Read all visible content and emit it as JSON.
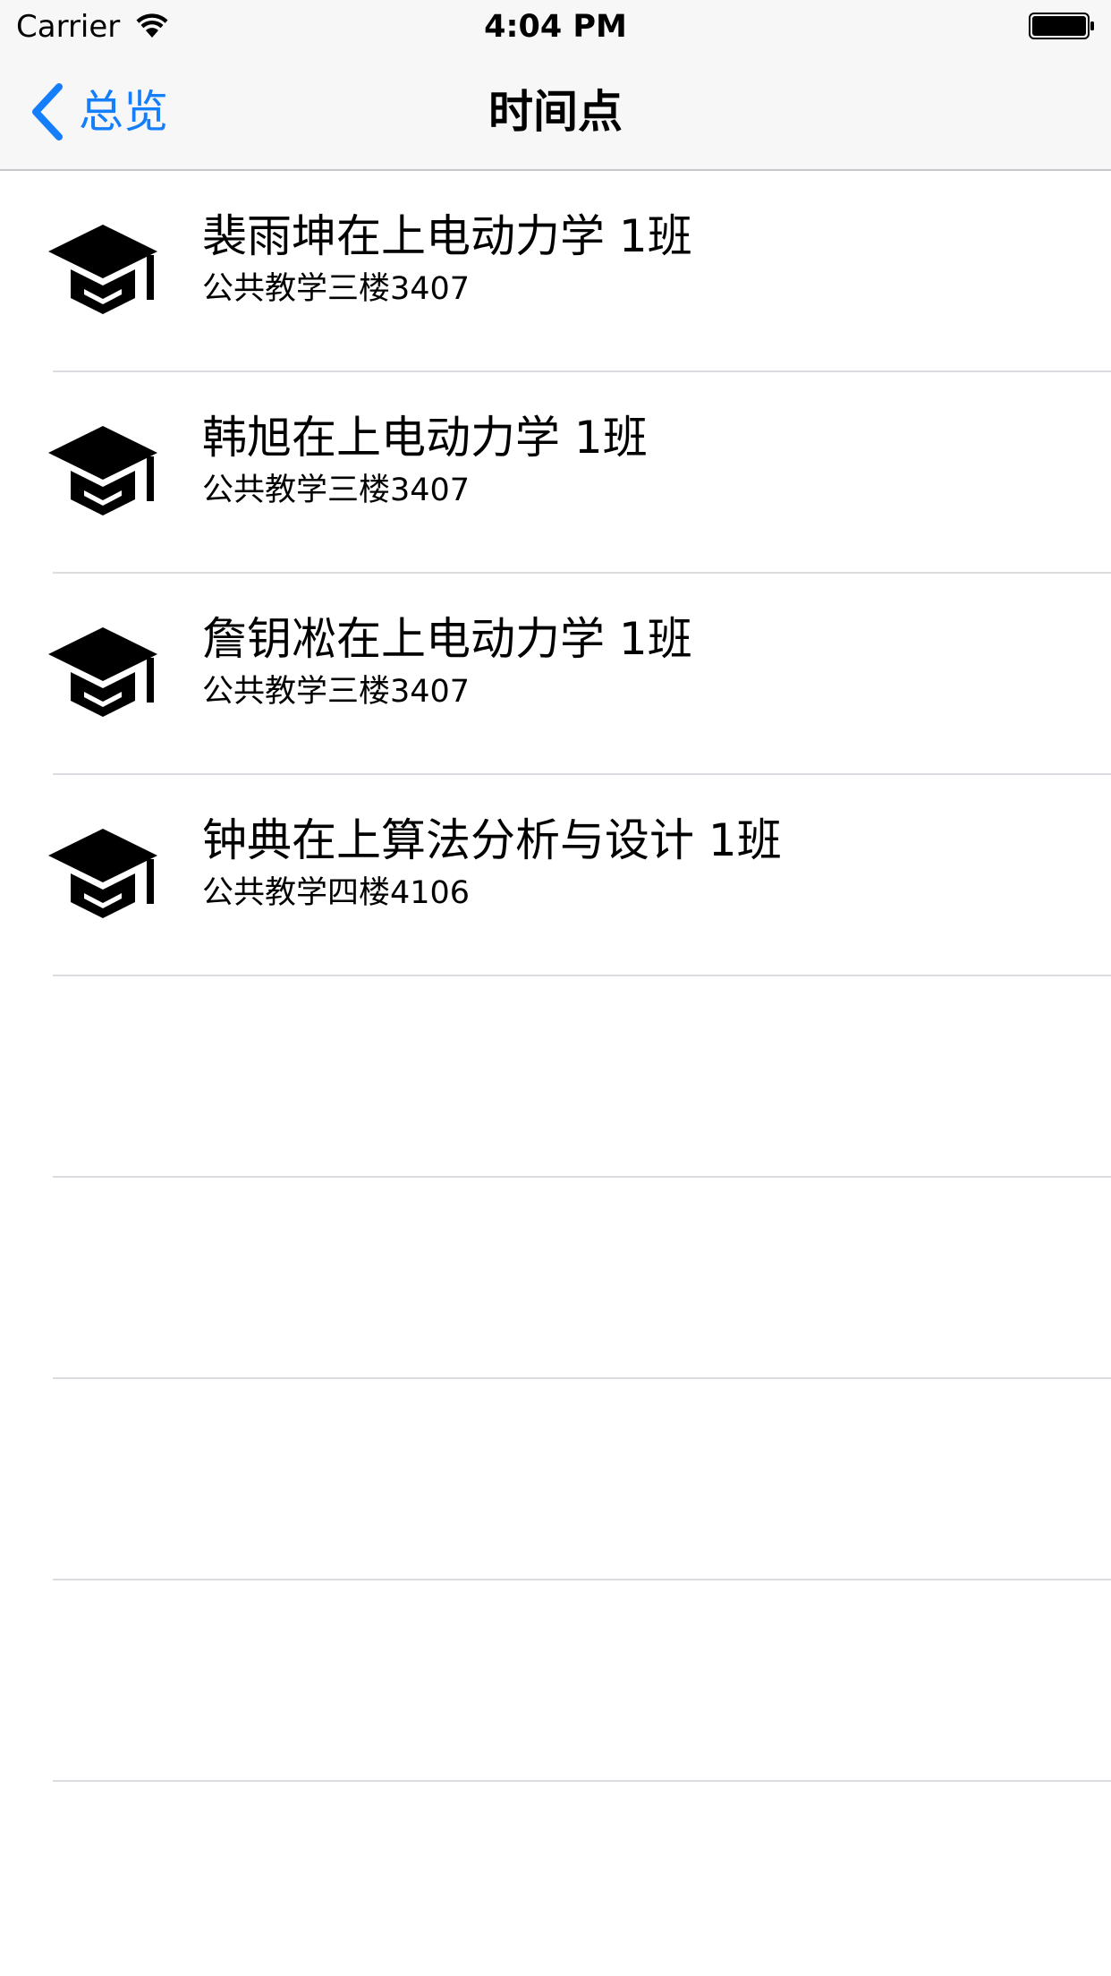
{
  "status_bar": {
    "carrier": "Carrier",
    "time": "4:04 PM",
    "wifi_icon": "wifi-icon",
    "battery_icon": "battery-full-icon"
  },
  "nav": {
    "back_label": "总览",
    "back_icon": "chevron-left-icon",
    "title": "时间点",
    "accent_color": "#157efb"
  },
  "rows": [
    {
      "icon": "graduation-cap-icon",
      "title": "裴雨坤在上电动力学 1班",
      "subtitle": "公共教学三楼3407"
    },
    {
      "icon": "graduation-cap-icon",
      "title": "韩旭在上电动力学 1班",
      "subtitle": "公共教学三楼3407"
    },
    {
      "icon": "graduation-cap-icon",
      "title": "詹钥凇在上电动力学 1班",
      "subtitle": "公共教学三楼3407"
    },
    {
      "icon": "graduation-cap-icon",
      "title": "钟典在上算法分析与设计 1班",
      "subtitle": "公共教学四楼4106"
    },
    {
      "icon": "",
      "title": "",
      "subtitle": ""
    },
    {
      "icon": "",
      "title": "",
      "subtitle": ""
    },
    {
      "icon": "",
      "title": "",
      "subtitle": ""
    },
    {
      "icon": "",
      "title": "",
      "subtitle": ""
    }
  ]
}
